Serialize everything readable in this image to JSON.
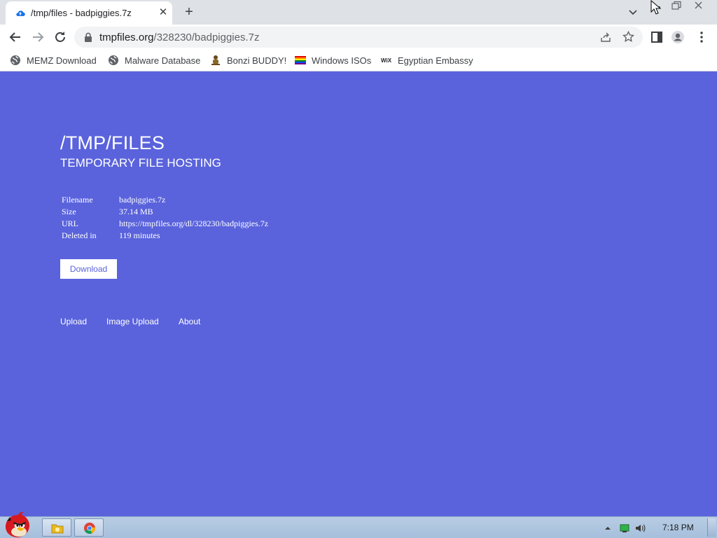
{
  "browser": {
    "tab_title": "/tmp/files - badpiggies.7z",
    "url_host": "tmpfiles.org",
    "url_path": "/328230/badpiggies.7z",
    "bookmarks": [
      {
        "label": "MEMZ Download",
        "icon": "globe-icon"
      },
      {
        "label": "Malware Database",
        "icon": "globe-icon"
      },
      {
        "label": "Bonzi BUDDY!",
        "icon": "bonzi-icon"
      },
      {
        "label": "Windows ISOs",
        "icon": "rainbow-flag-icon"
      },
      {
        "label": "Egyptian Embassy",
        "icon": "wix-icon",
        "icon_text": "WiX"
      }
    ]
  },
  "page": {
    "title": "/TMP/FILES",
    "subtitle": "TEMPORARY FILE HOSTING",
    "file_info": [
      {
        "key": "Filename",
        "value": "badpiggies.7z"
      },
      {
        "key": "Size",
        "value": "37.14 MB"
      },
      {
        "key": "URL",
        "value": "https://tmpfiles.org/dl/328230/badpiggies.7z"
      },
      {
        "key": "Deleted in",
        "value": "119 minutes"
      }
    ],
    "download_label": "Download",
    "footer_links": [
      "Upload",
      "Image Upload",
      "About"
    ]
  },
  "taskbar": {
    "clock": "7:18 PM"
  },
  "colors": {
    "page_background": "#5a63dc",
    "chrome_titlebar": "#dee1e6",
    "taskbar": "#b8cde4"
  }
}
